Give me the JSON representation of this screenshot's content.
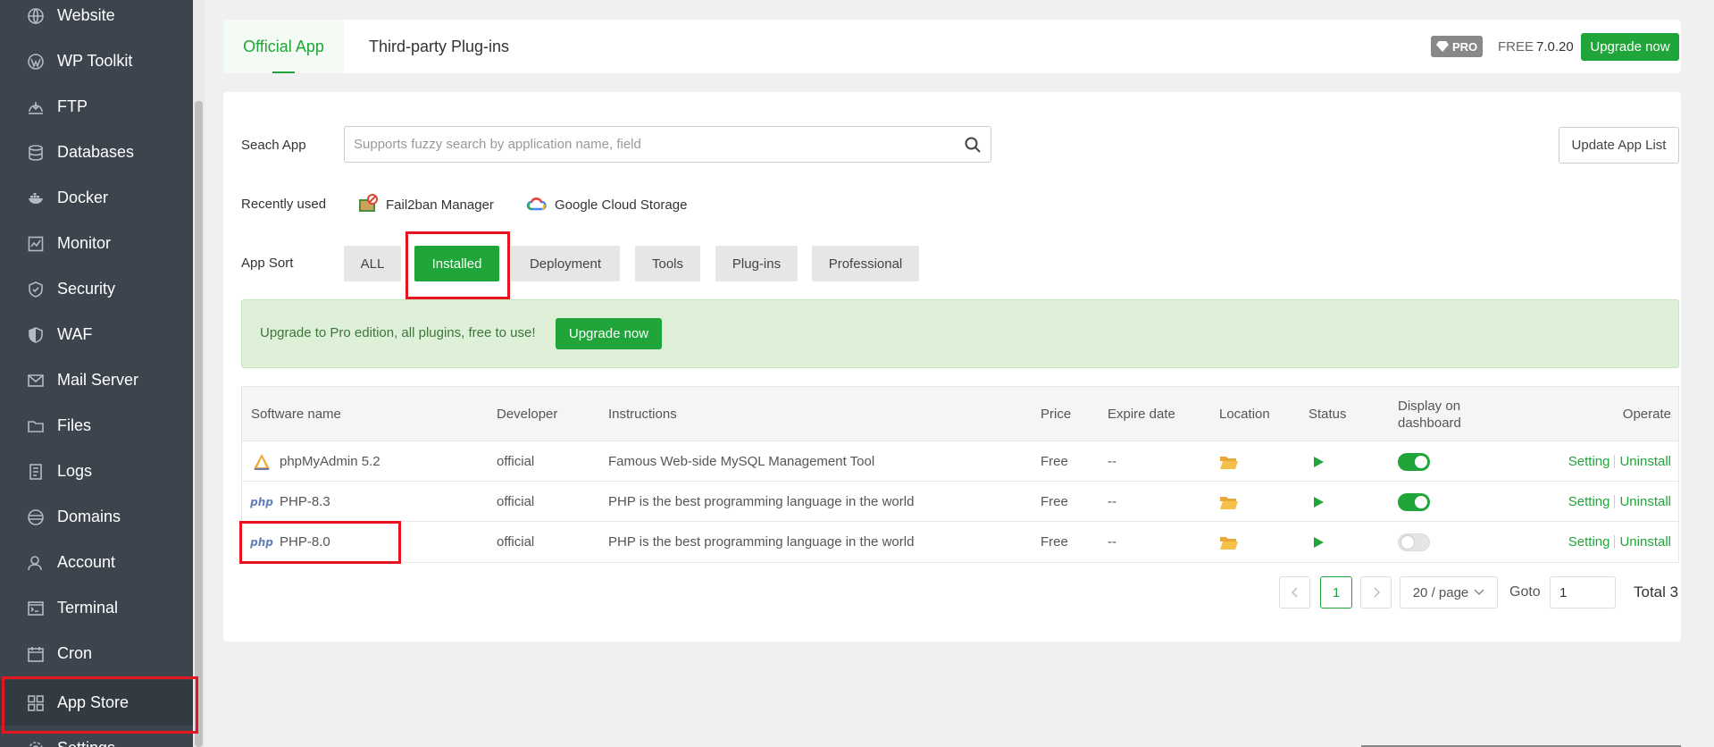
{
  "sidebar": {
    "items": [
      {
        "label": "Website",
        "icon": "globe-icon"
      },
      {
        "label": "WP Toolkit",
        "icon": "wordpress-icon"
      },
      {
        "label": "FTP",
        "icon": "ftp-icon"
      },
      {
        "label": "Databases",
        "icon": "database-icon"
      },
      {
        "label": "Docker",
        "icon": "docker-icon"
      },
      {
        "label": "Monitor",
        "icon": "monitor-icon"
      },
      {
        "label": "Security",
        "icon": "shield-icon"
      },
      {
        "label": "WAF",
        "icon": "waf-shield-icon"
      },
      {
        "label": "Mail Server",
        "icon": "mail-icon"
      },
      {
        "label": "Files",
        "icon": "folder-icon"
      },
      {
        "label": "Logs",
        "icon": "logs-icon"
      },
      {
        "label": "Domains",
        "icon": "domains-icon"
      },
      {
        "label": "Account",
        "icon": "user-icon"
      },
      {
        "label": "Terminal",
        "icon": "terminal-icon"
      },
      {
        "label": "Cron",
        "icon": "cron-icon"
      },
      {
        "label": "App Store",
        "icon": "grid-icon",
        "active": true
      },
      {
        "label": "Settings",
        "icon": "gear-icon"
      }
    ]
  },
  "tabs": {
    "official": "Official App",
    "third_party": "Third-party Plug-ins"
  },
  "header": {
    "pro_badge": "PRO",
    "edition": "FREE",
    "version": "7.0.20",
    "upgrade_label": "Upgrade now"
  },
  "search": {
    "label": "Seach App",
    "placeholder": "Supports fuzzy search by application name, field",
    "update_button": "Update App List"
  },
  "recently_used": {
    "label": "Recently used",
    "items": [
      "Fail2ban Manager",
      "Google Cloud Storage"
    ]
  },
  "app_sort": {
    "label": "App Sort",
    "options": [
      "ALL",
      "Installed",
      "Deployment",
      "Tools",
      "Plug-ins",
      "Professional"
    ],
    "active": "Installed"
  },
  "promo": {
    "text": "Upgrade to Pro edition, all plugins, free to use!",
    "button": "Upgrade now"
  },
  "table": {
    "columns": {
      "name": "Software name",
      "developer": "Developer",
      "instructions": "Instructions",
      "price": "Price",
      "expire": "Expire date",
      "location": "Location",
      "status": "Status",
      "display_line1": "Display on",
      "display_line2": "dashboard",
      "operate": "Operate"
    },
    "rows": [
      {
        "name": "phpMyAdmin 5.2",
        "developer": "official",
        "instructions": "Famous Web-side MySQL Management Tool",
        "price": "Free",
        "expire": "--",
        "dashboard": true,
        "setting": "Setting",
        "uninstall": "Uninstall"
      },
      {
        "name": "PHP-8.3",
        "developer": "official",
        "instructions": "PHP is the best programming language in the world",
        "price": "Free",
        "expire": "--",
        "dashboard": true,
        "setting": "Setting",
        "uninstall": "Uninstall"
      },
      {
        "name": "PHP-8.0",
        "developer": "official",
        "instructions": "PHP is the best programming language in the world",
        "price": "Free",
        "expire": "--",
        "dashboard": false,
        "setting": "Setting",
        "uninstall": "Uninstall"
      }
    ],
    "php_logo_text": "php"
  },
  "pagination": {
    "current_page": "1",
    "page_size": "20 / page",
    "goto_label": "Goto",
    "goto_value": "1",
    "total": "Total 3"
  },
  "colors": {
    "accent": "#20a53a",
    "sidebar_bg": "#3c444d",
    "highlight": "#e5141f"
  }
}
